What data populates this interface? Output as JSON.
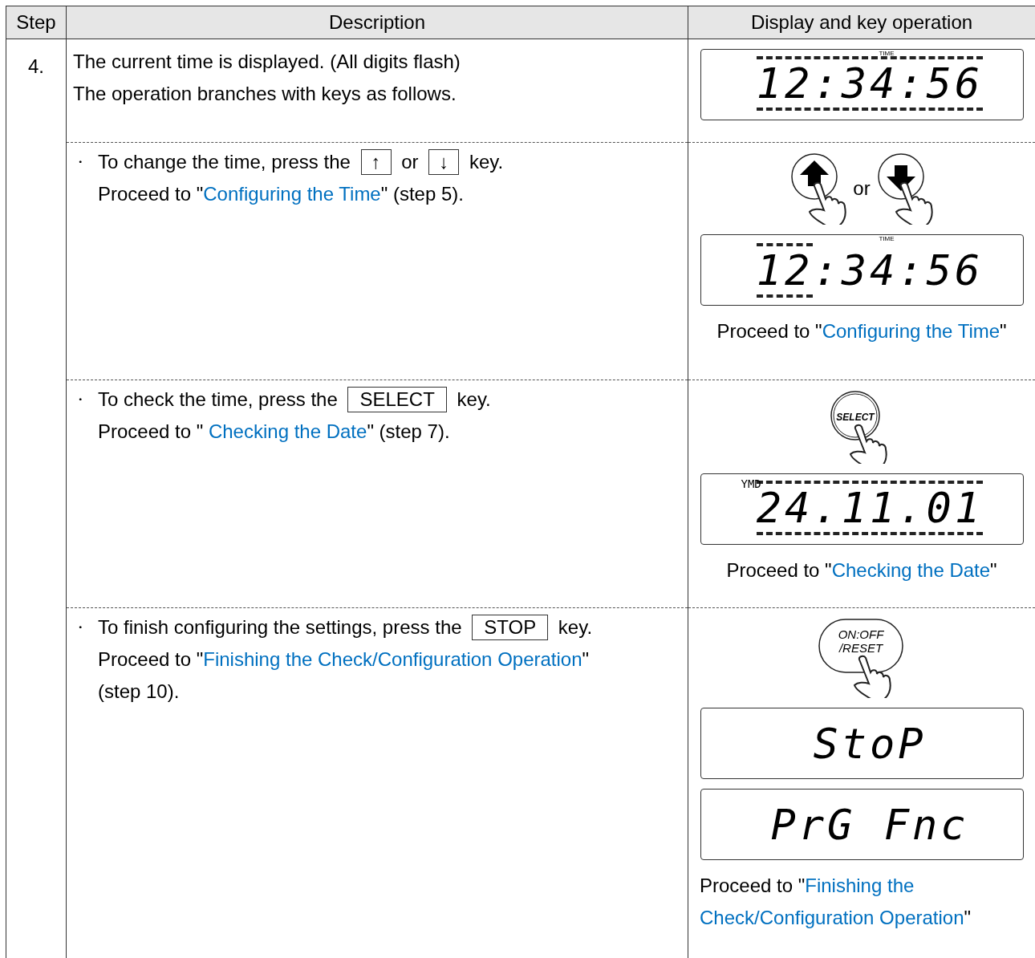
{
  "columns": [
    "Step",
    "Description",
    "Display and key operation"
  ],
  "step": "4.",
  "rows": [
    {
      "lines": [
        {
          "parts": [
            {
              "kind": "text",
              "text": "The current time is displayed. (All digits flash)"
            }
          ]
        },
        {
          "parts": [
            {
              "kind": "text",
              "text": "The operation branches with keys as follows."
            }
          ]
        }
      ],
      "display": [
        {
          "kind": "lcd",
          "indicator": "TIME",
          "segments": [
            {
              "text": "12:34:56",
              "flashing": true
            }
          ]
        }
      ]
    },
    {
      "lines": [
        {
          "bullet": "・",
          "parts": [
            {
              "kind": "text",
              "text": "To change the time, press the"
            },
            {
              "kind": "key",
              "text": "↑"
            },
            {
              "kind": "text",
              "text": "or"
            },
            {
              "kind": "key",
              "text": "↓"
            },
            {
              "kind": "text",
              "text": "key."
            }
          ]
        },
        {
          "parts": [
            {
              "kind": "text",
              "text": "Proceed to \""
            },
            {
              "kind": "link",
              "text": "Configuring the Time"
            },
            {
              "kind": "text",
              "text": "\" (step 5)."
            }
          ]
        }
      ],
      "display": [
        {
          "kind": "arrow-keys",
          "separator": "or"
        },
        {
          "kind": "lcd",
          "indicator": "TIME",
          "segments": [
            {
              "text": "12",
              "flashing": true
            },
            {
              "text": ":34:56",
              "flashing": false
            }
          ]
        },
        {
          "kind": "caption",
          "parts": [
            {
              "kind": "text",
              "text": "Proceed to \""
            },
            {
              "kind": "link",
              "text": "Configuring the Time"
            },
            {
              "kind": "text",
              "text": "\""
            }
          ]
        }
      ]
    },
    {
      "lines": [
        {
          "bullet": "・",
          "parts": [
            {
              "kind": "text",
              "text": "To check the time, press the"
            },
            {
              "kind": "key",
              "text": "SELECT"
            },
            {
              "kind": "text",
              "text": "key."
            }
          ]
        },
        {
          "parts": [
            {
              "kind": "text",
              "text": "Proceed to \" "
            },
            {
              "kind": "link",
              "text": "Checking the Date"
            },
            {
              "kind": "text",
              "text": "\" (step 7)."
            }
          ]
        }
      ],
      "display": [
        {
          "kind": "round-key",
          "lines": [
            "SELECT"
          ]
        },
        {
          "kind": "lcd",
          "indicator": "YMD",
          "segments": [
            {
              "text": "24.11.01",
              "flashing": true
            }
          ]
        },
        {
          "kind": "caption",
          "parts": [
            {
              "kind": "text",
              "text": "Proceed to \""
            },
            {
              "kind": "link",
              "text": "Checking the Date"
            },
            {
              "kind": "text",
              "text": "\""
            }
          ]
        }
      ]
    },
    {
      "lines": [
        {
          "bullet": "・",
          "parts": [
            {
              "kind": "text",
              "text": "To finish configuring the settings, press the"
            },
            {
              "kind": "key",
              "text": "STOP"
            },
            {
              "kind": "text",
              "text": "key."
            }
          ]
        },
        {
          "parts": [
            {
              "kind": "text",
              "text": "Proceed to \""
            },
            {
              "kind": "link",
              "text": "Finishing the Check/Configuration Operation"
            },
            {
              "kind": "text",
              "text": "\""
            }
          ]
        },
        {
          "parts": [
            {
              "kind": "text",
              "text": "(step 10)."
            }
          ]
        }
      ],
      "display": [
        {
          "kind": "oval-key",
          "lines": [
            "ON:OFF",
            "/RESET"
          ]
        },
        {
          "kind": "lcd",
          "segments": [
            {
              "text": "StoP",
              "flashing": false
            }
          ]
        },
        {
          "kind": "lcd",
          "segments": [
            {
              "text": "PrG Fnc",
              "flashing": false
            }
          ]
        },
        {
          "kind": "caption",
          "parts": [
            {
              "kind": "text",
              "text": "Proceed to \""
            },
            {
              "kind": "link",
              "text": "Finishing the"
            },
            {
              "kind": "link",
              "text": "Check/Configuration Operation"
            },
            {
              "kind": "text",
              "text": "\""
            }
          ]
        }
      ]
    }
  ]
}
